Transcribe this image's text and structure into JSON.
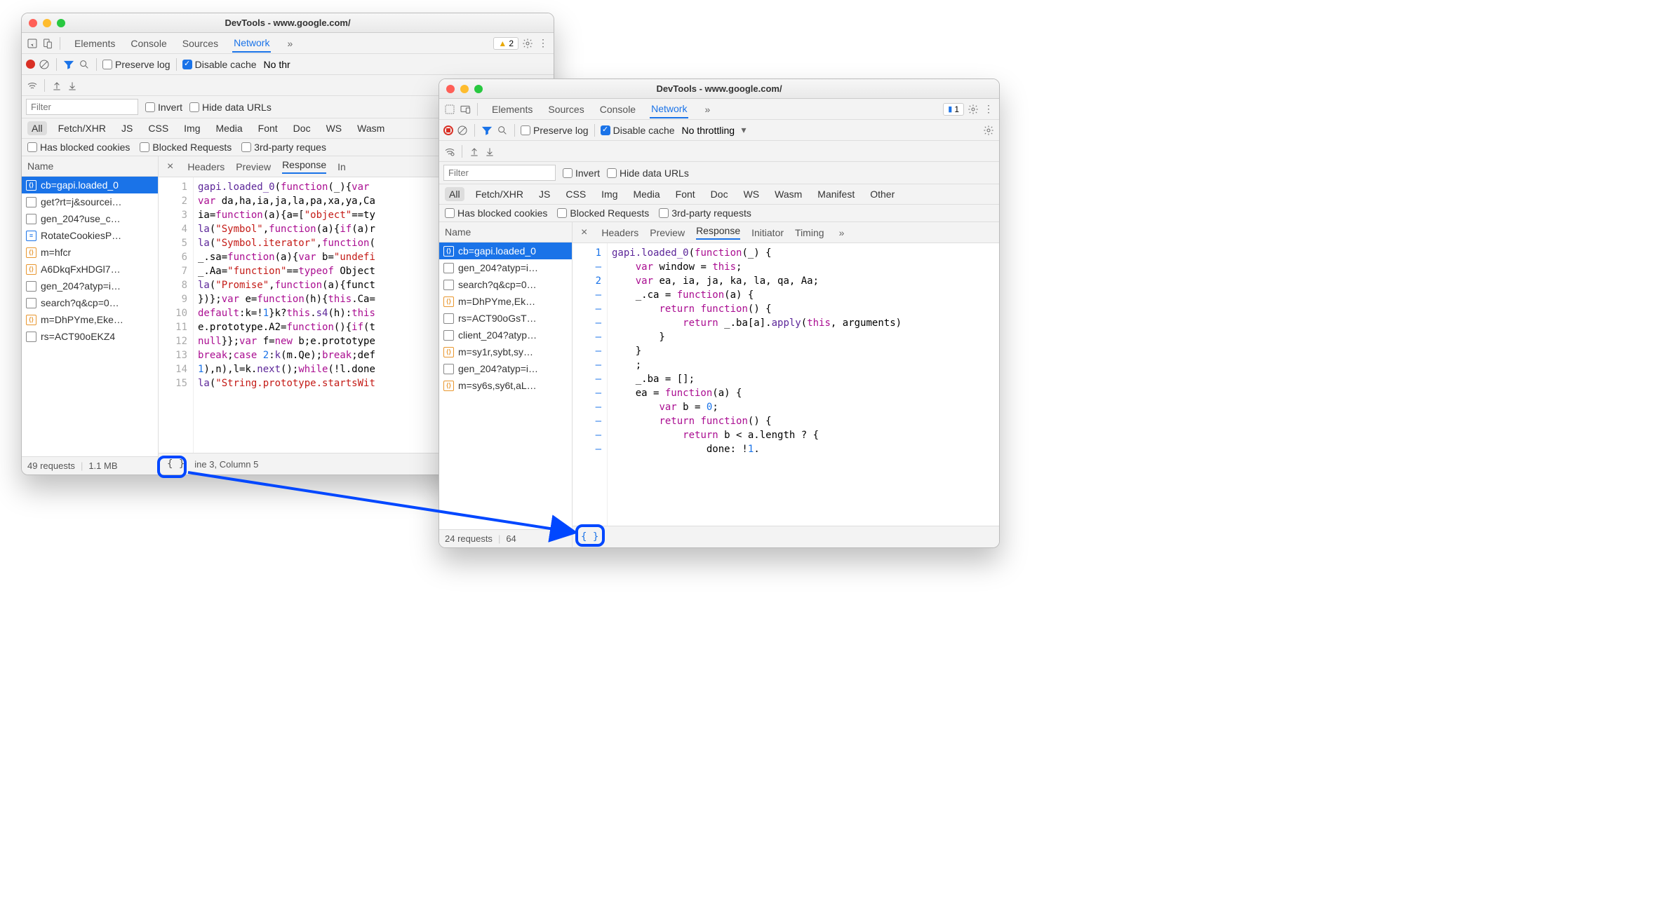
{
  "window_a": {
    "title": "DevTools - www.google.com/",
    "tabs": [
      "Elements",
      "Console",
      "Sources",
      "Network"
    ],
    "active_tab": "Network",
    "warning_badge": "2",
    "preserve_log": "Preserve log",
    "disable_cache": "Disable cache",
    "throttling": "No thr",
    "filter_placeholder": "Filter",
    "invert": "Invert",
    "hide_data_urls": "Hide data URLs",
    "types": [
      "All",
      "Fetch/XHR",
      "JS",
      "CSS",
      "Img",
      "Media",
      "Font",
      "Doc",
      "WS",
      "Wasm"
    ],
    "has_blocked": "Has blocked cookies",
    "blocked_req": "Blocked Requests",
    "third_party": "3rd-party reques",
    "name_header": "Name",
    "requests": [
      {
        "name": "cb=gapi.loaded_0",
        "icon": "js",
        "selected": true
      },
      {
        "name": "get?rt=j&sourcei…",
        "icon": "doc"
      },
      {
        "name": "gen_204?use_c…",
        "icon": "doc"
      },
      {
        "name": "RotateCookiesP…",
        "icon": "blue"
      },
      {
        "name": "m=hfcr",
        "icon": "js"
      },
      {
        "name": "A6DkqFxHDGl7…",
        "icon": "js"
      },
      {
        "name": "gen_204?atyp=i…",
        "icon": "doc"
      },
      {
        "name": "search?q&cp=0…",
        "icon": "doc"
      },
      {
        "name": "m=DhPYme,Eke…",
        "icon": "js"
      },
      {
        "name": "rs=ACT90oEKZ4",
        "icon": "doc"
      }
    ],
    "footer_requests": "49 requests",
    "footer_size": "1.1 MB",
    "detail_tabs": [
      "Headers",
      "Preview",
      "Response",
      "In"
    ],
    "detail_active": "Response",
    "code_lines": [
      "gapi.loaded_0(function(_){var ",
      "var da,ha,ia,ja,la,pa,xa,ya,Ca",
      "ia=function(a){a=[\"object\"==ty",
      "la(\"Symbol\",function(a){if(a)r",
      "la(\"Symbol.iterator\",function(",
      "_.sa=function(a){var b=\"undefi",
      "_.Aa=\"function\"==typeof Object",
      "la(\"Promise\",function(a){funct",
      "})};var e=function(h){this.Ca=",
      "default:k=!1}k?this.s4(h):this",
      "e.prototype.A2=function(){if(t",
      "null}};var f=new b;e.prototype",
      "break;case 2:k(m.Qe);break;def",
      "1),n),l=k.next();while(!l.done",
      "la(\"String.prototype.startsWit"
    ],
    "cursor_status": "ine 3, Column 5"
  },
  "window_b": {
    "title": "DevTools - www.google.com/",
    "tabs": [
      "Elements",
      "Sources",
      "Console",
      "Network"
    ],
    "active_tab": "Network",
    "msg_badge": "1",
    "preserve_log": "Preserve log",
    "disable_cache": "Disable cache",
    "throttling": "No throttling",
    "filter_placeholder": "Filter",
    "invert": "Invert",
    "hide_data_urls": "Hide data URLs",
    "types": [
      "All",
      "Fetch/XHR",
      "JS",
      "CSS",
      "Img",
      "Media",
      "Font",
      "Doc",
      "WS",
      "Wasm",
      "Manifest",
      "Other"
    ],
    "has_blocked": "Has blocked cookies",
    "blocked_req": "Blocked Requests",
    "third_party": "3rd-party requests",
    "name_header": "Name",
    "requests": [
      {
        "name": "cb=gapi.loaded_0",
        "icon": "js",
        "selected": true
      },
      {
        "name": "gen_204?atyp=i…",
        "icon": "doc"
      },
      {
        "name": "search?q&cp=0…",
        "icon": "doc"
      },
      {
        "name": "m=DhPYme,Ek…",
        "icon": "js"
      },
      {
        "name": "rs=ACT90oGsT…",
        "icon": "doc"
      },
      {
        "name": "client_204?atyp…",
        "icon": "doc"
      },
      {
        "name": "m=sy1r,sybt,sy…",
        "icon": "js"
      },
      {
        "name": "gen_204?atyp=i…",
        "icon": "doc"
      },
      {
        "name": "m=sy6s,sy6t,aL…",
        "icon": "js"
      }
    ],
    "footer_requests": "24 requests",
    "footer_size": "64",
    "detail_tabs": [
      "Headers",
      "Preview",
      "Response",
      "Initiator",
      "Timing"
    ],
    "detail_active": "Response",
    "gutter": [
      "1",
      "–",
      "2",
      "–",
      "–",
      "–",
      "–",
      "–",
      "–",
      "–",
      "–",
      "–",
      "–",
      "–",
      "–",
      "–"
    ],
    "code_lines": [
      "gapi.loaded_0(function(_) {",
      "    var window = this;",
      "    var ea, ia, ja, ka, la, qa, Aa;",
      "    _.ca = function(a) {",
      "        return function() {",
      "            return _.ba[a].apply(this, arguments)",
      "        }",
      "    }",
      "    ;",
      "    _.ba = [];",
      "    ea = function(a) {",
      "        var b = 0;",
      "        return function() {",
      "            return b < a.length ? {",
      "                done: !1."
    ]
  }
}
